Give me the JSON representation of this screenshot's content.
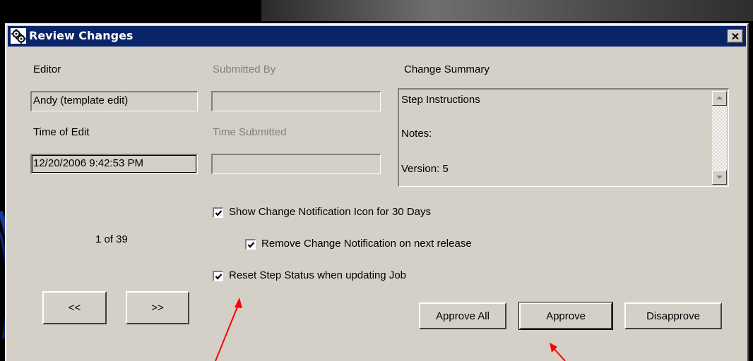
{
  "dialog": {
    "title": "Review Changes",
    "editor_label": "Editor",
    "editor_value": "Andy (template edit)",
    "time_of_edit_label": "Time of Edit",
    "time_of_edit_value": "12/20/2006 9:42:53 PM",
    "submitted_by_label": "Submitted By",
    "submitted_by_value": "",
    "time_submitted_label": "Time Submitted",
    "time_submitted_value": "",
    "change_summary_label": "Change Summary",
    "change_summary_lines": [
      "Step Instructions",
      "Notes:",
      "Version:  5"
    ],
    "checkboxes": [
      {
        "label": "Show Change Notification Icon for 30 Days",
        "checked": true
      },
      {
        "label": "Remove Change Notification on next release",
        "checked": true
      },
      {
        "label": "Reset Step Status when updating Job",
        "checked": true
      }
    ],
    "pager": "1 of 39",
    "prev_label": "<<",
    "next_label": ">>",
    "approve_all_label": "Approve All",
    "approve_label": "Approve",
    "disapprove_label": "Disapprove"
  },
  "colors": {
    "titlebar": "#0a246a",
    "dialog_bg": "#d4d0c8",
    "annotation_arrow": "#ff0000"
  },
  "icons": {
    "title_icon": "gears-icon",
    "close": "close-icon",
    "scroll_up": "scroll-up-arrow-icon",
    "scroll_down": "scroll-down-arrow-icon",
    "check": "checkmark-icon"
  }
}
